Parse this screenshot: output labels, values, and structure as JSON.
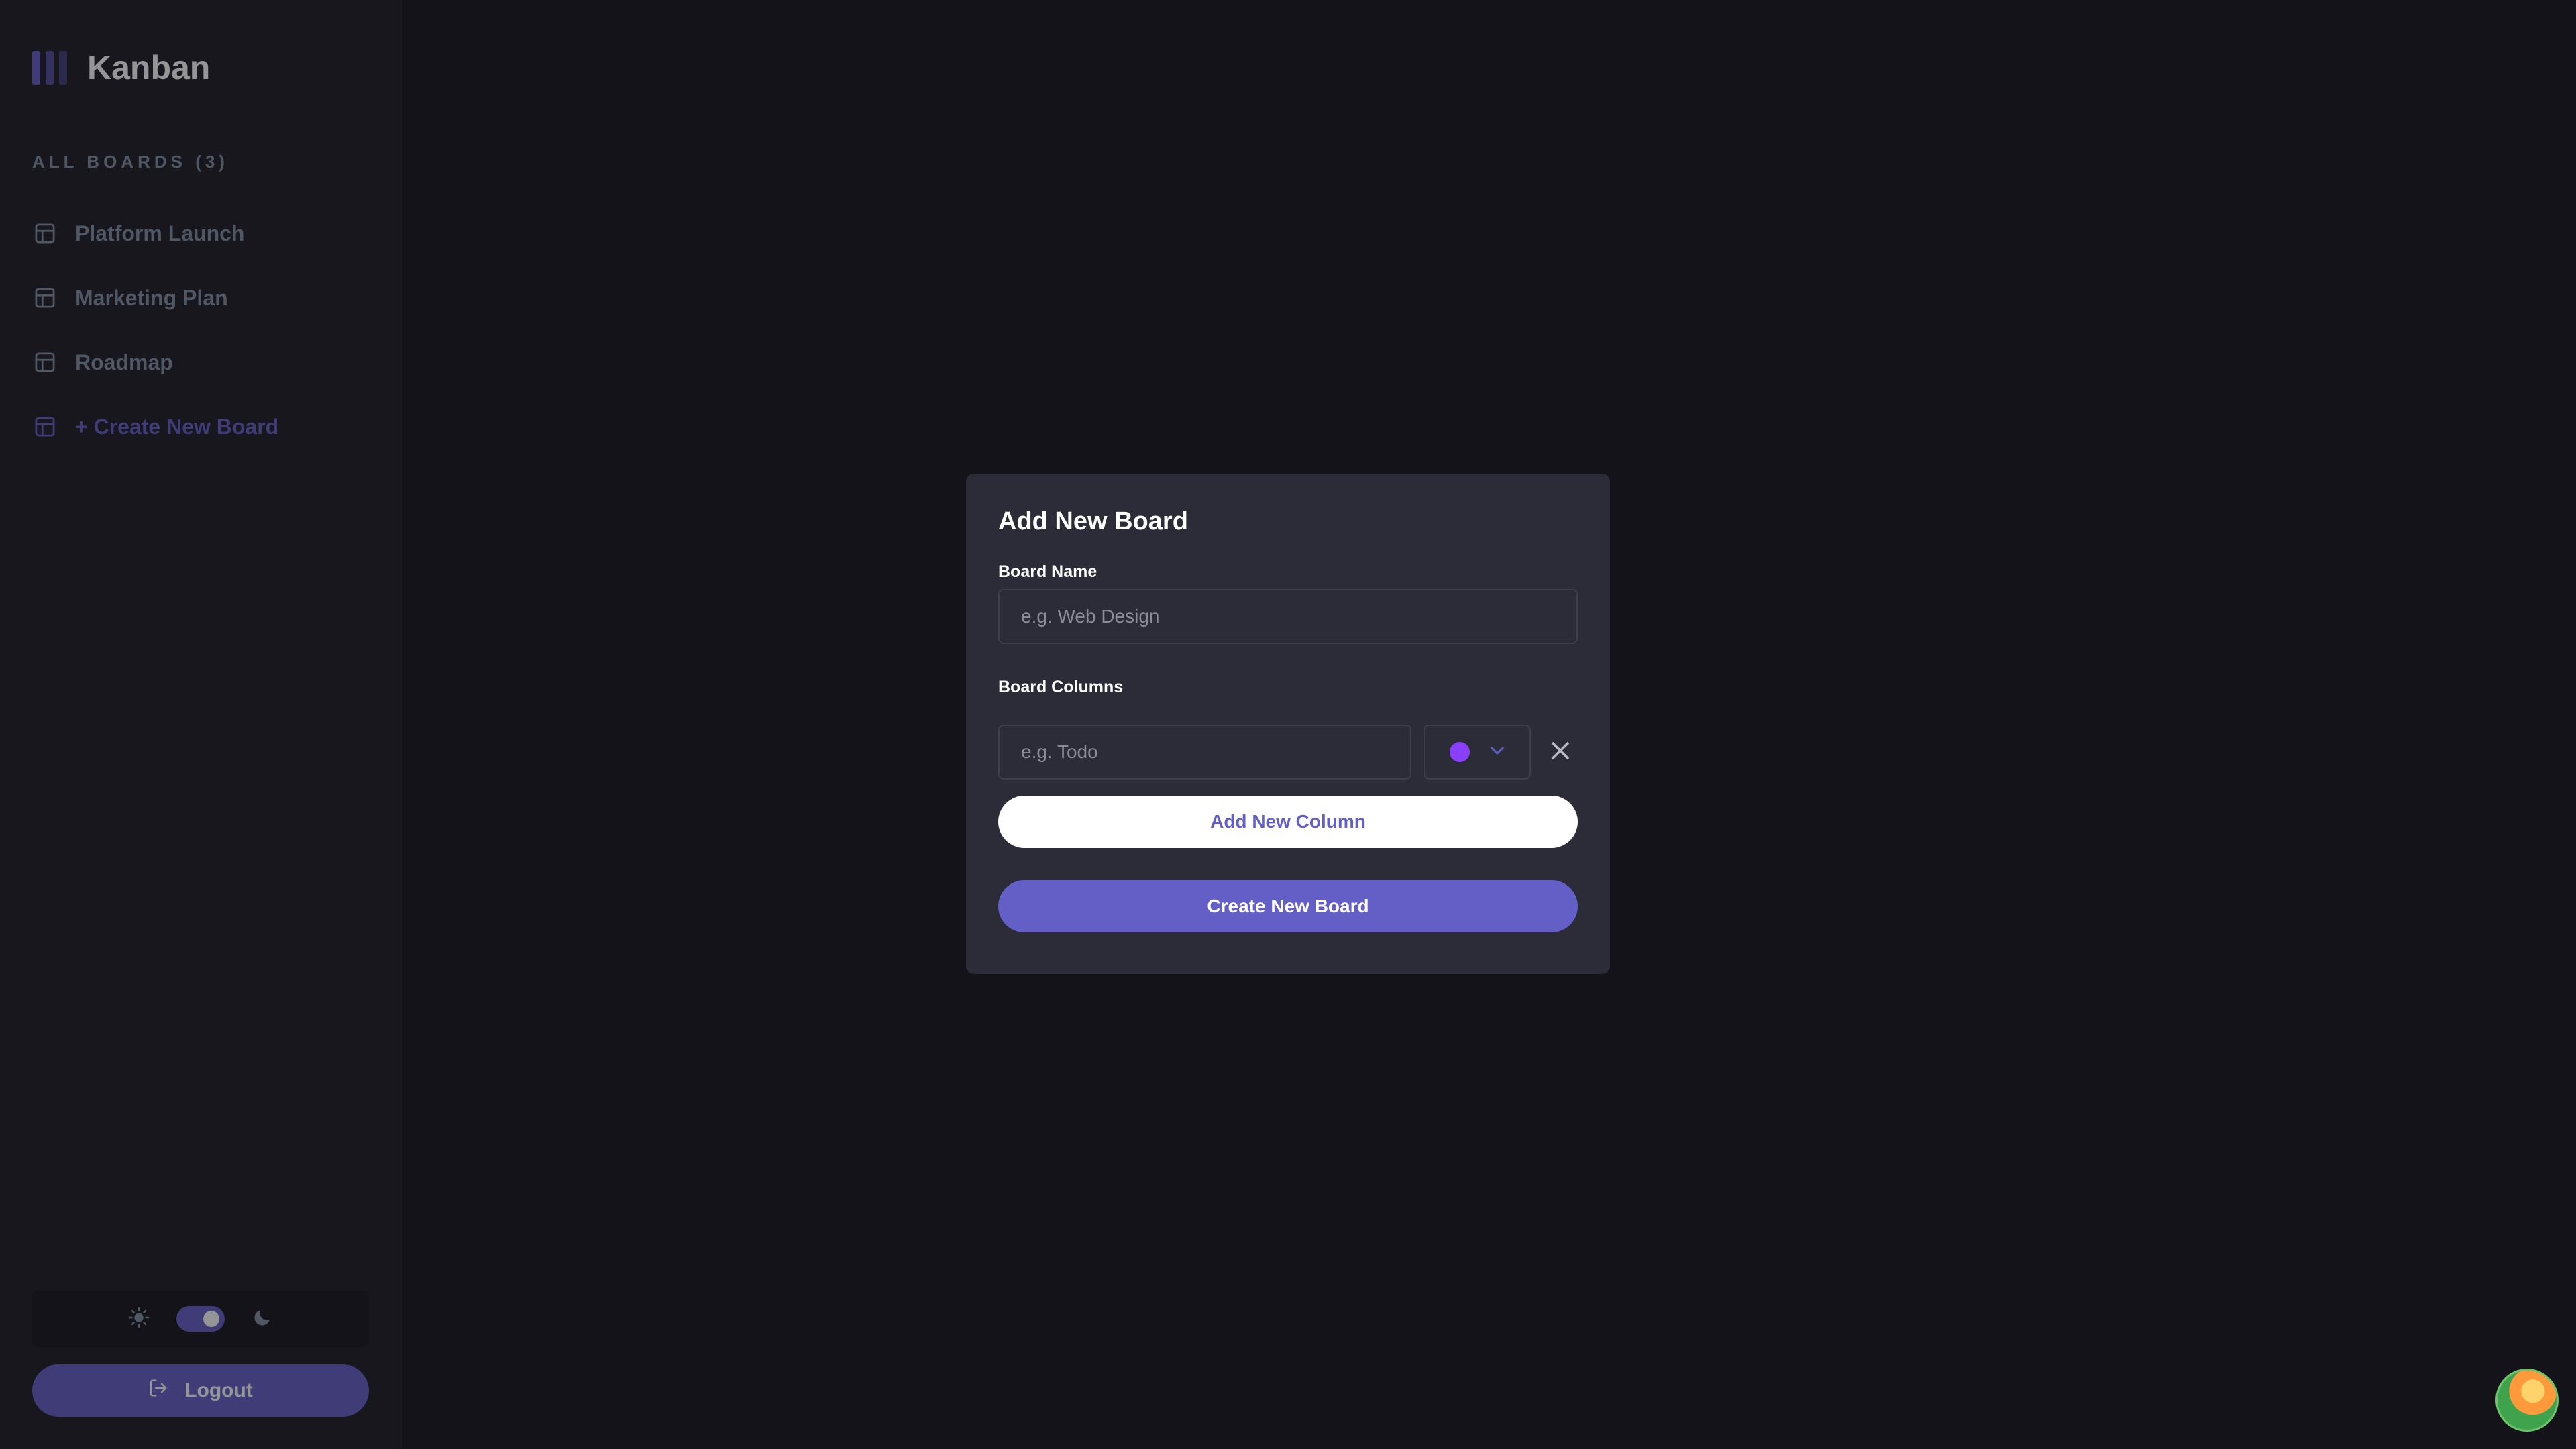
{
  "app": {
    "logo_text": "Kanban",
    "accent_color": "#635fc7"
  },
  "sidebar": {
    "heading": "ALL BOARDS (3)",
    "items": [
      {
        "label": "Platform Launch",
        "icon": "board-icon"
      },
      {
        "label": "Marketing Plan",
        "icon": "board-icon"
      },
      {
        "label": "Roadmap",
        "icon": "board-icon"
      }
    ],
    "create_label": "+ Create New Board",
    "theme": {
      "light_icon": "sun-icon",
      "dark_icon": "moon-icon",
      "mode": "dark"
    },
    "logout_label": "Logout"
  },
  "modal": {
    "title": "Add New Board",
    "name_label": "Board Name",
    "name_placeholder": "e.g. Web Design",
    "name_value": "",
    "columns_label": "Board Columns",
    "columns": [
      {
        "placeholder": "e.g. Todo",
        "value": "",
        "color": "#8a3ffc"
      }
    ],
    "add_column_label": "Add New Column",
    "submit_label": "Create New Board"
  }
}
